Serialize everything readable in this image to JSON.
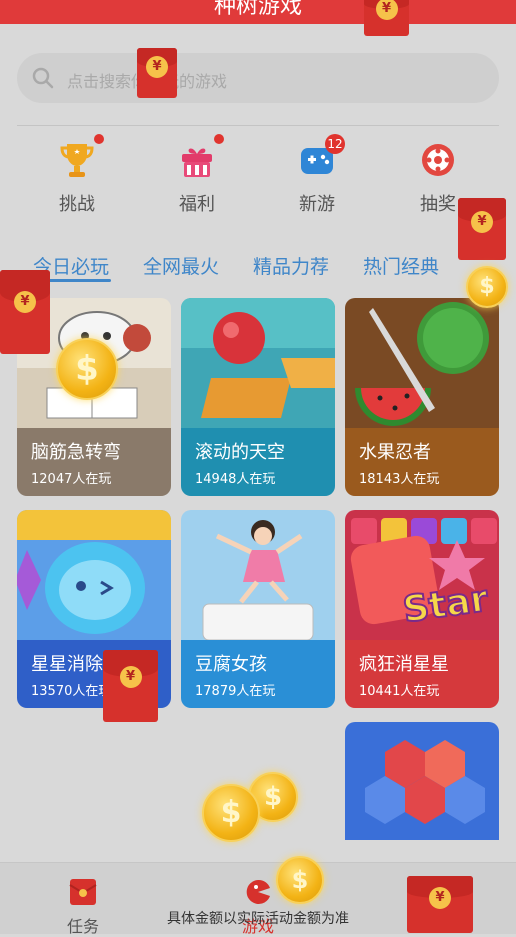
{
  "header": {
    "title": "种树游戏"
  },
  "search": {
    "placeholder": "点击搜索你想玩的游戏"
  },
  "categories": [
    {
      "label": "挑战",
      "icon": "trophy-icon",
      "dot": true
    },
    {
      "label": "福利",
      "icon": "gift-icon",
      "dot": true
    },
    {
      "label": "新游",
      "icon": "gamepad-icon",
      "badge": "12"
    },
    {
      "label": "抽奖",
      "icon": "lottery-wheel-icon"
    }
  ],
  "tabs": [
    "今日必玩",
    "全网最火",
    "精品力荐",
    "热门经典"
  ],
  "active_tab": 0,
  "games": [
    {
      "name": "脑筋急转弯",
      "players": "12047人在玩",
      "color": "#8a7a6a"
    },
    {
      "name": "滚动的天空",
      "players": "14948人在玩",
      "color": "#1f8fb0"
    },
    {
      "name": "水果忍者",
      "players": "18143人在玩",
      "color": "#9a5a1e"
    },
    {
      "name": "星星消除",
      "players": "13570人在玩",
      "color": "#2f5fc8"
    },
    {
      "name": "豆腐女孩",
      "players": "17879人在玩",
      "color": "#2a8fd6"
    },
    {
      "name": "疯狂消星星",
      "players": "10441人在玩",
      "color": "#d5393c"
    }
  ],
  "bottom_nav": [
    {
      "label": "任务",
      "icon": "task-envelope-icon"
    },
    {
      "label": "游戏",
      "icon": "game-pacman-icon"
    }
  ],
  "disclaimer": "具体金额以实际活动金额为准",
  "coin_symbol": "$",
  "envelope_symbol": "¥"
}
